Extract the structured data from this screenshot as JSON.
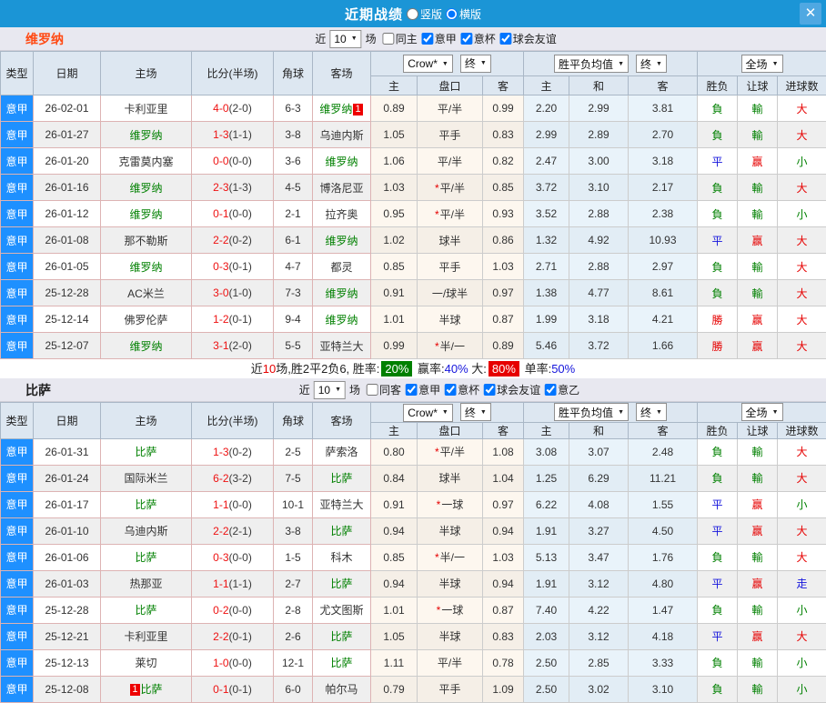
{
  "titlebar": {
    "title": "近期战绩",
    "layout_options": [
      {
        "label": "竖版",
        "selected": false
      },
      {
        "label": "横版",
        "selected": true
      }
    ],
    "close_icon": "✕"
  },
  "colors": {
    "titlebar_blue": "#1b95d6",
    "league_blue": "#1e90ff",
    "team_green": "#008000",
    "red": "#e60000",
    "link_blue": "#1414dc",
    "verona_orange": "#ff4a14"
  },
  "table_header": {
    "static_cols": [
      "类型",
      "日期",
      "主场",
      "比分(半场)",
      "角球",
      "客场"
    ],
    "bookmaker_dropdown": "Crow*",
    "final_dropdown": "终",
    "mean_dropdown": "胜平负均值",
    "final_dropdown2": "终",
    "fullmatch_dropdown": "全场",
    "sub_cols": [
      "主",
      "盘口",
      "客",
      "主",
      "和",
      "客",
      "胜负",
      "让球",
      "进球数"
    ]
  },
  "sections": [
    {
      "team": "维罗纳",
      "team_color": "#ff4a14",
      "filters": {
        "prefix": "近",
        "count": "10",
        "suffix": "场",
        "options": [
          {
            "label": "同主",
            "checked": false
          },
          {
            "label": "意甲",
            "checked": true
          },
          {
            "label": "意杯",
            "checked": true
          },
          {
            "label": "球会友谊",
            "checked": true
          }
        ]
      },
      "rows": [
        {
          "league": "意甲",
          "date": "26-02-01",
          "home": "卡利亚里",
          "home_team": false,
          "home_badge": "",
          "ft": "4-0",
          "ht": "(2-0)",
          "corners": "6-3",
          "away": "维罗纳",
          "away_team": true,
          "away_badge": "1",
          "o_home": "0.89",
          "handicap": "平/半",
          "star": false,
          "o_away": "0.99",
          "m_home": "2.20",
          "m_draw": "2.99",
          "m_away": "3.81",
          "res_wdl": "負",
          "res_wdl_c": "green",
          "res_let": "輸",
          "res_let_c": "green",
          "res_goal": "大",
          "res_goal_c": "red"
        },
        {
          "league": "意甲",
          "date": "26-01-27",
          "home": "维罗纳",
          "home_team": true,
          "home_badge": "",
          "ft": "1-3",
          "ht": "(1-1)",
          "corners": "3-8",
          "away": "乌迪内斯",
          "away_team": false,
          "away_badge": "",
          "o_home": "1.05",
          "handicap": "平手",
          "star": false,
          "o_away": "0.83",
          "m_home": "2.99",
          "m_draw": "2.89",
          "m_away": "2.70",
          "res_wdl": "負",
          "res_wdl_c": "green",
          "res_let": "輸",
          "res_let_c": "green",
          "res_goal": "大",
          "res_goal_c": "red"
        },
        {
          "league": "意甲",
          "date": "26-01-20",
          "home": "克雷莫内塞",
          "home_team": false,
          "home_badge": "",
          "ft": "0-0",
          "ht": "(0-0)",
          "corners": "3-6",
          "away": "维罗纳",
          "away_team": true,
          "away_badge": "",
          "o_home": "1.06",
          "handicap": "平/半",
          "star": false,
          "o_away": "0.82",
          "m_home": "2.47",
          "m_draw": "3.00",
          "m_away": "3.18",
          "res_wdl": "平",
          "res_wdl_c": "blue",
          "res_let": "赢",
          "res_let_c": "red",
          "res_goal": "小",
          "res_goal_c": "green"
        },
        {
          "league": "意甲",
          "date": "26-01-16",
          "home": "维罗纳",
          "home_team": true,
          "home_badge": "",
          "ft": "2-3",
          "ht": "(1-3)",
          "corners": "4-5",
          "away": "博洛尼亚",
          "away_team": false,
          "away_badge": "",
          "o_home": "1.03",
          "handicap": "平/半",
          "star": true,
          "o_away": "0.85",
          "m_home": "3.72",
          "m_draw": "3.10",
          "m_away": "2.17",
          "res_wdl": "負",
          "res_wdl_c": "green",
          "res_let": "輸",
          "res_let_c": "green",
          "res_goal": "大",
          "res_goal_c": "red"
        },
        {
          "league": "意甲",
          "date": "26-01-12",
          "home": "维罗纳",
          "home_team": true,
          "home_badge": "",
          "ft": "0-1",
          "ht": "(0-0)",
          "corners": "2-1",
          "away": "拉齐奥",
          "away_team": false,
          "away_badge": "",
          "o_home": "0.95",
          "handicap": "平/半",
          "star": true,
          "o_away": "0.93",
          "m_home": "3.52",
          "m_draw": "2.88",
          "m_away": "2.38",
          "res_wdl": "負",
          "res_wdl_c": "green",
          "res_let": "輸",
          "res_let_c": "green",
          "res_goal": "小",
          "res_goal_c": "green"
        },
        {
          "league": "意甲",
          "date": "26-01-08",
          "home": "那不勒斯",
          "home_team": false,
          "home_badge": "",
          "ft": "2-2",
          "ht": "(0-2)",
          "corners": "6-1",
          "away": "维罗纳",
          "away_team": true,
          "away_badge": "",
          "o_home": "1.02",
          "handicap": "球半",
          "star": false,
          "o_away": "0.86",
          "m_home": "1.32",
          "m_draw": "4.92",
          "m_away": "10.93",
          "res_wdl": "平",
          "res_wdl_c": "blue",
          "res_let": "赢",
          "res_let_c": "red",
          "res_goal": "大",
          "res_goal_c": "red"
        },
        {
          "league": "意甲",
          "date": "26-01-05",
          "home": "维罗纳",
          "home_team": true,
          "home_badge": "",
          "ft": "0-3",
          "ht": "(0-1)",
          "corners": "4-7",
          "away": "都灵",
          "away_team": false,
          "away_badge": "",
          "o_home": "0.85",
          "handicap": "平手",
          "star": false,
          "o_away": "1.03",
          "m_home": "2.71",
          "m_draw": "2.88",
          "m_away": "2.97",
          "res_wdl": "負",
          "res_wdl_c": "green",
          "res_let": "輸",
          "res_let_c": "green",
          "res_goal": "大",
          "res_goal_c": "red"
        },
        {
          "league": "意甲",
          "date": "25-12-28",
          "home": "AC米兰",
          "home_team": false,
          "home_badge": "",
          "ft": "3-0",
          "ht": "(1-0)",
          "corners": "7-3",
          "away": "维罗纳",
          "away_team": true,
          "away_badge": "",
          "o_home": "0.91",
          "handicap": "一/球半",
          "star": false,
          "o_away": "0.97",
          "m_home": "1.38",
          "m_draw": "4.77",
          "m_away": "8.61",
          "res_wdl": "負",
          "res_wdl_c": "green",
          "res_let": "輸",
          "res_let_c": "green",
          "res_goal": "大",
          "res_goal_c": "red"
        },
        {
          "league": "意甲",
          "date": "25-12-14",
          "home": "佛罗伦萨",
          "home_team": false,
          "home_badge": "",
          "ft": "1-2",
          "ht": "(0-1)",
          "corners": "9-4",
          "away": "维罗纳",
          "away_team": true,
          "away_badge": "",
          "o_home": "1.01",
          "handicap": "半球",
          "star": false,
          "o_away": "0.87",
          "m_home": "1.99",
          "m_draw": "3.18",
          "m_away": "4.21",
          "res_wdl": "勝",
          "res_wdl_c": "red",
          "res_let": "赢",
          "res_let_c": "red",
          "res_goal": "大",
          "res_goal_c": "red"
        },
        {
          "league": "意甲",
          "date": "25-12-07",
          "home": "维罗纳",
          "home_team": true,
          "home_badge": "",
          "ft": "3-1",
          "ht": "(2-0)",
          "corners": "5-5",
          "away": "亚特兰大",
          "away_team": false,
          "away_badge": "",
          "o_home": "0.99",
          "handicap": "半/一",
          "star": true,
          "o_away": "0.89",
          "m_home": "5.46",
          "m_draw": "3.72",
          "m_away": "1.66",
          "res_wdl": "勝",
          "res_wdl_c": "red",
          "res_let": "赢",
          "res_let_c": "red",
          "res_goal": "大",
          "res_goal_c": "red"
        }
      ],
      "summary": [
        {
          "text": "近"
        },
        {
          "text": "10",
          "color": "red"
        },
        {
          "text": "场,胜2平2负6, 胜率:"
        },
        {
          "text": "20%",
          "bg": "green"
        },
        {
          "text": " 赢率:"
        },
        {
          "text": "40%",
          "color": "blue"
        },
        {
          "text": " 大:"
        },
        {
          "text": "80%",
          "bg": "red"
        },
        {
          "text": " 单率:"
        },
        {
          "text": "50%",
          "color": "blue"
        }
      ]
    },
    {
      "team": "比萨",
      "team_color": "#222222",
      "filters": {
        "prefix": "近",
        "count": "10",
        "suffix": "场",
        "options": [
          {
            "label": "同客",
            "checked": false
          },
          {
            "label": "意甲",
            "checked": true
          },
          {
            "label": "意杯",
            "checked": true
          },
          {
            "label": "球会友谊",
            "checked": true
          },
          {
            "label": "意乙",
            "checked": true
          }
        ]
      },
      "rows": [
        {
          "league": "意甲",
          "date": "26-01-31",
          "home": "比萨",
          "home_team": true,
          "home_badge": "",
          "ft": "1-3",
          "ht": "(0-2)",
          "corners": "2-5",
          "away": "萨索洛",
          "away_team": false,
          "away_badge": "",
          "o_home": "0.80",
          "handicap": "平/半",
          "star": true,
          "o_away": "1.08",
          "m_home": "3.08",
          "m_draw": "3.07",
          "m_away": "2.48",
          "res_wdl": "負",
          "res_wdl_c": "green",
          "res_let": "輸",
          "res_let_c": "green",
          "res_goal": "大",
          "res_goal_c": "red"
        },
        {
          "league": "意甲",
          "date": "26-01-24",
          "home": "国际米兰",
          "home_team": false,
          "home_badge": "",
          "ft": "6-2",
          "ht": "(3-2)",
          "corners": "7-5",
          "away": "比萨",
          "away_team": true,
          "away_badge": "",
          "o_home": "0.84",
          "handicap": "球半",
          "star": false,
          "o_away": "1.04",
          "m_home": "1.25",
          "m_draw": "6.29",
          "m_away": "11.21",
          "res_wdl": "負",
          "res_wdl_c": "green",
          "res_let": "輸",
          "res_let_c": "green",
          "res_goal": "大",
          "res_goal_c": "red"
        },
        {
          "league": "意甲",
          "date": "26-01-17",
          "home": "比萨",
          "home_team": true,
          "home_badge": "",
          "ft": "1-1",
          "ht": "(0-0)",
          "corners": "10-1",
          "away": "亚特兰大",
          "away_team": false,
          "away_badge": "",
          "o_home": "0.91",
          "handicap": "一球",
          "star": true,
          "o_away": "0.97",
          "m_home": "6.22",
          "m_draw": "4.08",
          "m_away": "1.55",
          "res_wdl": "平",
          "res_wdl_c": "blue",
          "res_let": "赢",
          "res_let_c": "red",
          "res_goal": "小",
          "res_goal_c": "green"
        },
        {
          "league": "意甲",
          "date": "26-01-10",
          "home": "乌迪内斯",
          "home_team": false,
          "home_badge": "",
          "ft": "2-2",
          "ht": "(2-1)",
          "corners": "3-8",
          "away": "比萨",
          "away_team": true,
          "away_badge": "",
          "o_home": "0.94",
          "handicap": "半球",
          "star": false,
          "o_away": "0.94",
          "m_home": "1.91",
          "m_draw": "3.27",
          "m_away": "4.50",
          "res_wdl": "平",
          "res_wdl_c": "blue",
          "res_let": "赢",
          "res_let_c": "red",
          "res_goal": "大",
          "res_goal_c": "red"
        },
        {
          "league": "意甲",
          "date": "26-01-06",
          "home": "比萨",
          "home_team": true,
          "home_badge": "",
          "ft": "0-3",
          "ht": "(0-0)",
          "corners": "1-5",
          "away": "科木",
          "away_team": false,
          "away_badge": "",
          "o_home": "0.85",
          "handicap": "半/一",
          "star": true,
          "o_away": "1.03",
          "m_home": "5.13",
          "m_draw": "3.47",
          "m_away": "1.76",
          "res_wdl": "負",
          "res_wdl_c": "green",
          "res_let": "輸",
          "res_let_c": "green",
          "res_goal": "大",
          "res_goal_c": "red"
        },
        {
          "league": "意甲",
          "date": "26-01-03",
          "home": "热那亚",
          "home_team": false,
          "home_badge": "",
          "ft": "1-1",
          "ht": "(1-1)",
          "corners": "2-7",
          "away": "比萨",
          "away_team": true,
          "away_badge": "",
          "o_home": "0.94",
          "handicap": "半球",
          "star": false,
          "o_away": "0.94",
          "m_home": "1.91",
          "m_draw": "3.12",
          "m_away": "4.80",
          "res_wdl": "平",
          "res_wdl_c": "blue",
          "res_let": "赢",
          "res_let_c": "red",
          "res_goal": "走",
          "res_goal_c": "blue"
        },
        {
          "league": "意甲",
          "date": "25-12-28",
          "home": "比萨",
          "home_team": true,
          "home_badge": "",
          "ft": "0-2",
          "ht": "(0-0)",
          "corners": "2-8",
          "away": "尤文图斯",
          "away_team": false,
          "away_badge": "",
          "o_home": "1.01",
          "handicap": "一球",
          "star": true,
          "o_away": "0.87",
          "m_home": "7.40",
          "m_draw": "4.22",
          "m_away": "1.47",
          "res_wdl": "負",
          "res_wdl_c": "green",
          "res_let": "輸",
          "res_let_c": "green",
          "res_goal": "小",
          "res_goal_c": "green"
        },
        {
          "league": "意甲",
          "date": "25-12-21",
          "home": "卡利亚里",
          "home_team": false,
          "home_badge": "",
          "ft": "2-2",
          "ht": "(0-1)",
          "corners": "2-6",
          "away": "比萨",
          "away_team": true,
          "away_badge": "",
          "o_home": "1.05",
          "handicap": "半球",
          "star": false,
          "o_away": "0.83",
          "m_home": "2.03",
          "m_draw": "3.12",
          "m_away": "4.18",
          "res_wdl": "平",
          "res_wdl_c": "blue",
          "res_let": "赢",
          "res_let_c": "red",
          "res_goal": "大",
          "res_goal_c": "red"
        },
        {
          "league": "意甲",
          "date": "25-12-13",
          "home": "莱切",
          "home_team": false,
          "home_badge": "",
          "ft": "1-0",
          "ht": "(0-0)",
          "corners": "12-1",
          "away": "比萨",
          "away_team": true,
          "away_badge": "",
          "o_home": "1.11",
          "handicap": "平/半",
          "star": false,
          "o_away": "0.78",
          "m_home": "2.50",
          "m_draw": "2.85",
          "m_away": "3.33",
          "res_wdl": "負",
          "res_wdl_c": "green",
          "res_let": "輸",
          "res_let_c": "green",
          "res_goal": "小",
          "res_goal_c": "green"
        },
        {
          "league": "意甲",
          "date": "25-12-08",
          "home": "比萨",
          "home_team": true,
          "home_badge": "1",
          "ft": "0-1",
          "ht": "(0-1)",
          "corners": "6-0",
          "away": "帕尔马",
          "away_team": false,
          "away_badge": "",
          "o_home": "0.79",
          "handicap": "平手",
          "star": false,
          "o_away": "1.09",
          "m_home": "2.50",
          "m_draw": "3.02",
          "m_away": "3.10",
          "res_wdl": "負",
          "res_wdl_c": "green",
          "res_let": "輸",
          "res_let_c": "green",
          "res_goal": "小",
          "res_goal_c": "green"
        }
      ],
      "summary": null
    }
  ]
}
